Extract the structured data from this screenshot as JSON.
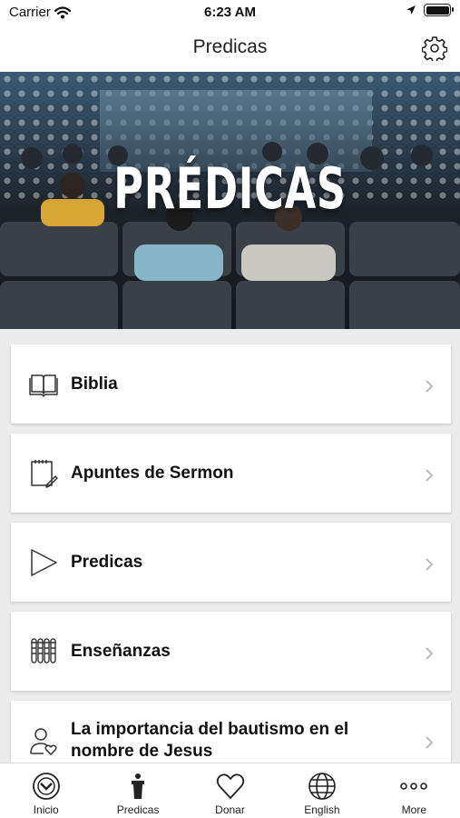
{
  "status_bar": {
    "carrier": "Carrier",
    "time": "6:23 AM"
  },
  "nav": {
    "title": "Predicas"
  },
  "hero": {
    "title": "PRÉDICAS"
  },
  "menu": [
    {
      "label": "Biblia",
      "icon": "open-book-icon"
    },
    {
      "label": "Apuntes de Sermon",
      "icon": "notepad-pencil-icon"
    },
    {
      "label": "Predicas",
      "icon": "play-triangle-icon"
    },
    {
      "label": "Enseñanzas",
      "icon": "test-tubes-icon"
    },
    {
      "label": "La importancia del bautismo en el nombre de Jesus",
      "icon": "person-heart-icon"
    }
  ],
  "tabs": [
    {
      "label": "Inicio",
      "icon": "chevron-circle-icon"
    },
    {
      "label": "Predicas",
      "icon": "podium-icon"
    },
    {
      "label": "Donar",
      "icon": "heart-icon"
    },
    {
      "label": "English",
      "icon": "globe-icon"
    },
    {
      "label": "More",
      "icon": "more-dots-icon"
    }
  ]
}
